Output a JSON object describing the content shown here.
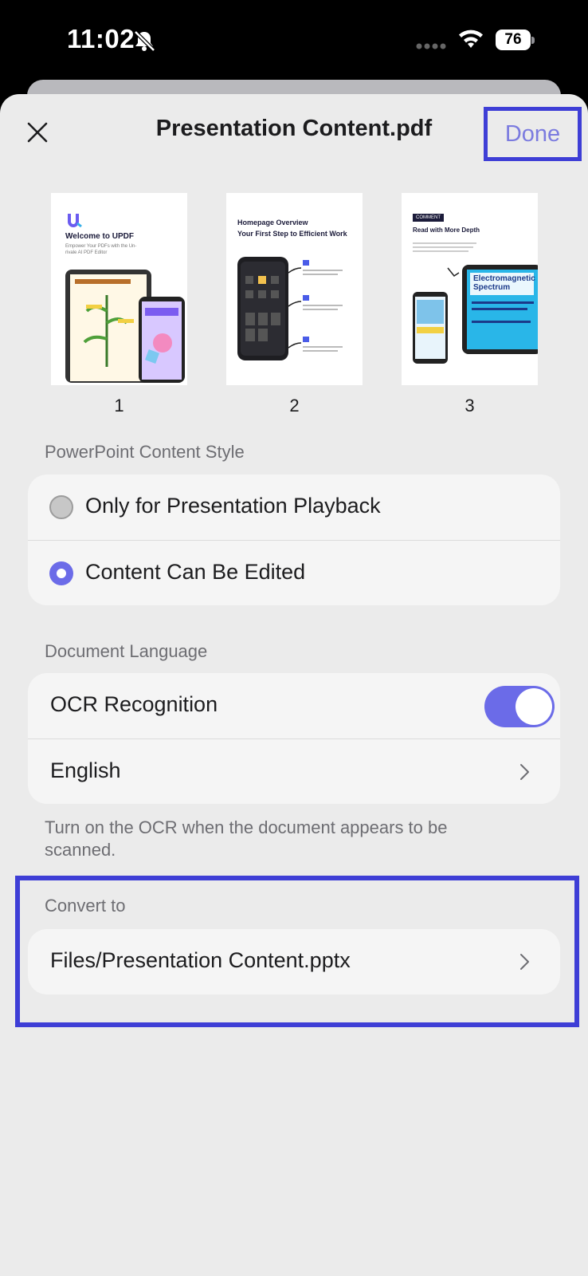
{
  "status_bar": {
    "time": "11:02",
    "battery": "76",
    "icons": [
      "bell-slash-icon",
      "signal-dots-icon",
      "wifi-icon",
      "battery-icon"
    ]
  },
  "header": {
    "title": "Presentation Content.pdf",
    "done_label": "Done",
    "close_icon": "close-icon"
  },
  "thumbnails": [
    {
      "number": "1",
      "heading": "Welcome to UPDF",
      "subtext": "Empower Your PDFs with the Un-\nrivale AI PDF Editor"
    },
    {
      "number": "2",
      "heading": "Homepage Overview\nYour First Step to Efficient Work",
      "subtext": ""
    },
    {
      "number": "3",
      "badge": "COMMENT",
      "heading": "Read with More Depth",
      "subtext": "Electromagnetic Spectrum"
    }
  ],
  "content_style": {
    "label": "PowerPoint Content Style",
    "options": [
      {
        "label": "Only for Presentation Playback",
        "selected": false
      },
      {
        "label": "Content Can Be Edited",
        "selected": true
      }
    ]
  },
  "document_language": {
    "label": "Document Language",
    "ocr_label": "OCR Recognition",
    "ocr_enabled": true,
    "language": "English",
    "help_text": "Turn on the OCR when the document appears to be scanned."
  },
  "convert": {
    "label": "Convert to",
    "path": "Files/Presentation Content.pptx"
  },
  "colors": {
    "accent": "#6b6be8",
    "highlight_box": "#3e3ed6",
    "background": "#ebebeb"
  }
}
